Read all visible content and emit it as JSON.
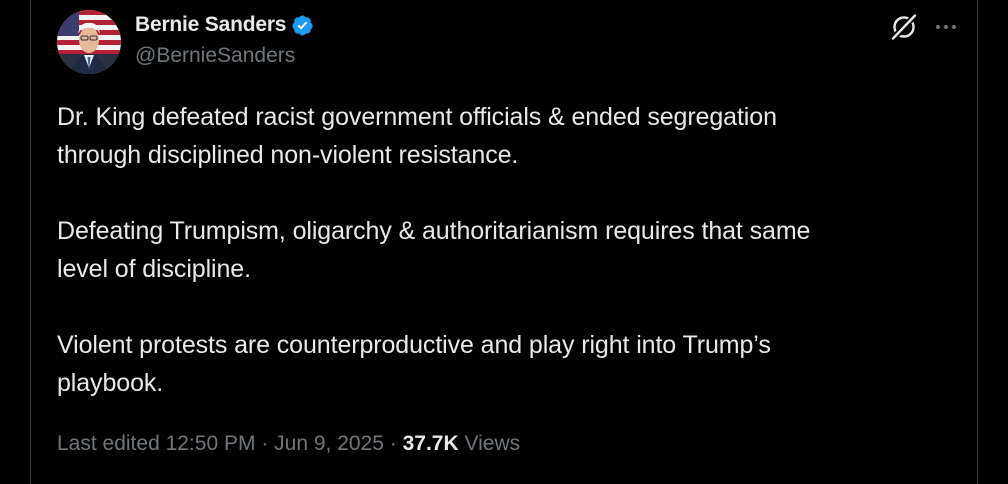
{
  "author": {
    "display_name": "Bernie Sanders",
    "handle": "@BernieSanders",
    "verified": true,
    "verified_color": "#1d9bf0"
  },
  "icons": {
    "verified": "verified-badge-icon",
    "grok": "grok-icon",
    "more": "more-options-icon"
  },
  "tweet": {
    "lines": [
      "Dr. King defeated racist government officials & ended segregation",
      "through disciplined non-violent resistance.",
      "Defeating Trumpism, oligarchy & authoritarianism requires that same",
      "level of discipline.",
      "Violent protests are counterproductive and play right into Trump’s",
      "playbook."
    ]
  },
  "meta": {
    "edited_label": "Last edited 12:50 PM",
    "separator": "·",
    "date": "Jun 9, 2025",
    "views_count": "37.7K",
    "views_label": "Views"
  },
  "colors": {
    "background": "#000000",
    "text": "#e7e9ea",
    "secondary": "#71767b",
    "border": "#2f3336"
  }
}
